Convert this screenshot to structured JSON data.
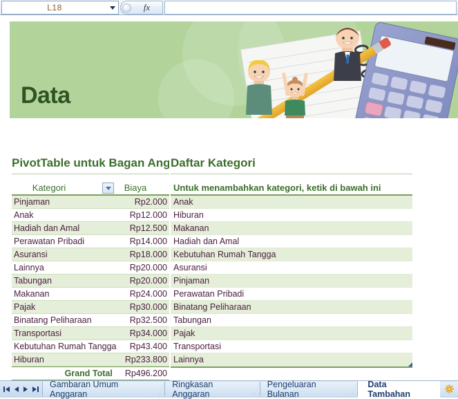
{
  "formula_bar": {
    "name_box_value": "L18",
    "name_box_dropdown_icon": "chevron-down-icon",
    "insert_function_icon": "insert-function-icon",
    "fx_label": "fx",
    "formula_value": ""
  },
  "banner": {
    "title": "Data",
    "background_color": "#b2d49b",
    "title_color": "#2f5422",
    "illustration": "budget-illustration-notebook-pencil-calculator-people"
  },
  "sections": {
    "pivot_heading": "PivotTable untuk Bagan Angga",
    "category_heading": "Daftar Kategori"
  },
  "pivot_table": {
    "columns": [
      "Kategori",
      "Biaya"
    ],
    "filter_icon": "filter-dropdown-icon",
    "rows": [
      {
        "category": "Pinjaman",
        "cost": "Rp2.000"
      },
      {
        "category": "Anak",
        "cost": "Rp12.000"
      },
      {
        "category": "Hadiah dan Amal",
        "cost": "Rp12.500"
      },
      {
        "category": "Perawatan Pribadi",
        "cost": "Rp14.000"
      },
      {
        "category": "Asuransi",
        "cost": "Rp18.000"
      },
      {
        "category": "Lainnya",
        "cost": "Rp20.000"
      },
      {
        "category": "Tabungan",
        "cost": "Rp20.000"
      },
      {
        "category": "Makanan",
        "cost": "Rp24.000"
      },
      {
        "category": "Pajak",
        "cost": "Rp30.000"
      },
      {
        "category": "Binatang Peliharaan",
        "cost": "Rp32.500"
      },
      {
        "category": "Transportasi",
        "cost": "Rp34.000"
      },
      {
        "category": "Kebutuhan Rumah Tangga",
        "cost": "Rp43.400"
      },
      {
        "category": "Hiburan",
        "cost": "Rp233.800"
      }
    ],
    "total_label": "Grand Total",
    "total_value": "Rp496.200"
  },
  "category_list": {
    "header": "Untuk menambahkan kategori, ketik di bawah ini",
    "items": [
      "Anak",
      "Hiburan",
      "Makanan",
      "Hadiah dan Amal",
      "Kebutuhan Rumah Tangga",
      "Asuransi",
      "Pinjaman",
      "Perawatan Pribadi",
      "Binatang Peliharaan",
      "Tabungan",
      "Pajak",
      "Transportasi",
      "Lainnya"
    ],
    "resize_handle_icon": "table-resize-handle-icon"
  },
  "sheet_tabs": {
    "nav_icons": [
      "first-sheet-icon",
      "previous-sheet-icon",
      "next-sheet-icon",
      "last-sheet-icon"
    ],
    "tabs": [
      {
        "label": "Gambaran Umum Anggaran",
        "active": false
      },
      {
        "label": "Ringkasan Anggaran",
        "active": false
      },
      {
        "label": "Pengeluaran Bulanan",
        "active": false
      },
      {
        "label": "Data Tambahan",
        "active": true
      }
    ],
    "insert_sheet_icon": "insert-worksheet-icon"
  },
  "colors": {
    "accent_green": "#7aa05e",
    "heading_green": "#3b6e2a",
    "band_green": "#e4eed8",
    "banner_green": "#b2d49b",
    "text_purple": "#4b2040",
    "tab_blue": "#1f3e6e"
  }
}
